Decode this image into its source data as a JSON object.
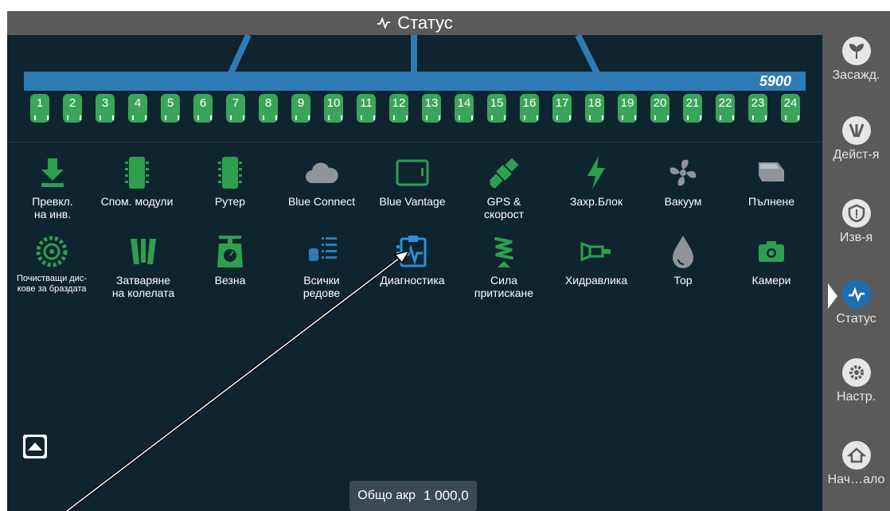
{
  "header": {
    "title": "Статус"
  },
  "planter": {
    "bar_value": "5900",
    "rows": [
      "1",
      "2",
      "3",
      "4",
      "5",
      "6",
      "7",
      "8",
      "9",
      "10",
      "11",
      "12",
      "13",
      "14",
      "15",
      "16",
      "17",
      "18",
      "19",
      "20",
      "21",
      "22",
      "23",
      "24"
    ]
  },
  "tiles_row1": [
    {
      "label": "Превкл.\nна инв.",
      "icon": "download-icon"
    },
    {
      "label": "Спом. модули",
      "icon": "module-icon"
    },
    {
      "label": "Рутер",
      "icon": "router-icon"
    },
    {
      "label": "Blue Connect",
      "icon": "cloud-icon"
    },
    {
      "label": "Blue Vantage",
      "icon": "tablet-icon"
    },
    {
      "label": "GPS &\nскорост",
      "icon": "satellite-icon"
    },
    {
      "label": "Захр.Блок",
      "icon": "lightning-icon"
    },
    {
      "label": "Вакуум",
      "icon": "fan-icon"
    },
    {
      "label": "Пълнене",
      "icon": "fill-icon"
    }
  ],
  "tiles_row2": [
    {
      "label": "Почистващи дис-\nкове за браздата",
      "icon": "disc-cleaner-icon"
    },
    {
      "label": "Затваряне\nна колелата",
      "icon": "closing-wheels-icon"
    },
    {
      "label": "Везна",
      "icon": "scale-icon"
    },
    {
      "label": "Всички\nредове",
      "icon": "all-rows-icon"
    },
    {
      "label": "Диагностика",
      "icon": "diagnostics-icon"
    },
    {
      "label": "Сила\nпритискане",
      "icon": "downforce-icon"
    },
    {
      "label": "Хидравлика",
      "icon": "hydraulics-icon"
    },
    {
      "label": "Тор",
      "icon": "fertilizer-icon"
    },
    {
      "label": "Камери",
      "icon": "camera-icon"
    }
  ],
  "sidebar": {
    "items": [
      {
        "label": "Засажд.",
        "icon": "planting-icon"
      },
      {
        "label": "Дейст-я",
        "icon": "actions-icon"
      },
      {
        "label": "Изв-я",
        "icon": "alerts-icon"
      },
      {
        "label": "Статус",
        "icon": "status-icon"
      },
      {
        "label": "Настр.",
        "icon": "settings-icon"
      },
      {
        "label": "Нач…ало",
        "icon": "home-icon"
      }
    ]
  },
  "footer": {
    "label": "Общо акр",
    "value": "1 000,0"
  },
  "colors": {
    "accent": "#1b6fb0",
    "row_green": "#3aa55a",
    "tile_green": "#2e9f4f",
    "bar_blue": "#2f7bb5",
    "bg": "#0e2530"
  }
}
